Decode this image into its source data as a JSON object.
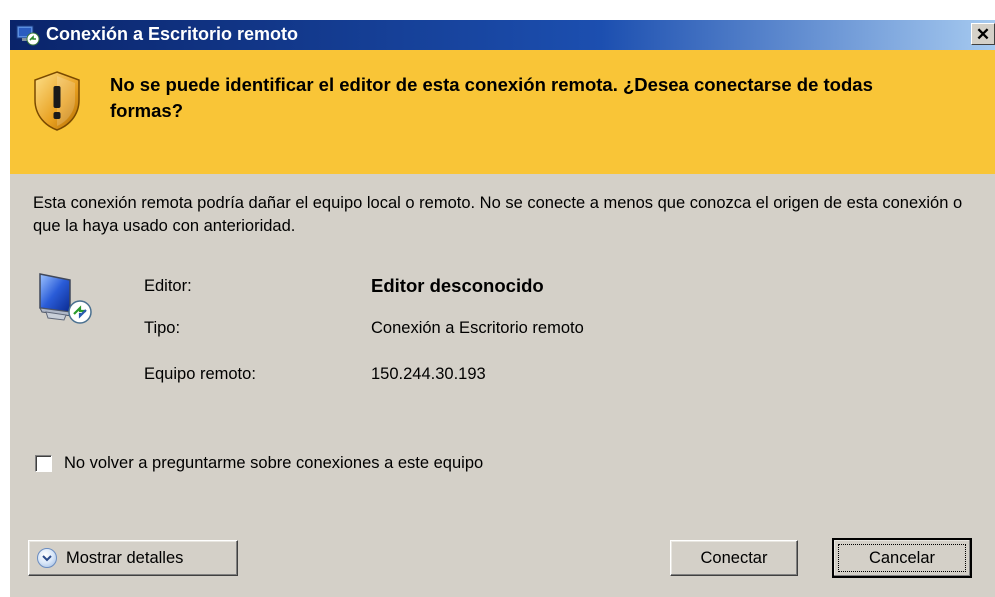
{
  "window": {
    "title": "Conexión a Escritorio remoto",
    "close_label": "✕"
  },
  "warning": {
    "message": "No se puede identificar el editor de esta conexión remota. ¿Desea conectarse de todas formas?",
    "color": "#f9c537"
  },
  "description": "Esta conexión remota podría dañar el equipo local o remoto. No se conecte a menos que conozca el origen de esta conexión o que la haya usado con anterioridad.",
  "info": [
    {
      "label": "Editor:",
      "value": "Editor desconocido"
    },
    {
      "label": "Tipo:",
      "value": "Conexión a Escritorio remoto"
    },
    {
      "label": "Equipo remoto:",
      "value": "150.244.30.193"
    }
  ],
  "checkbox": {
    "label": "No volver a preguntarme sobre conexiones a este equipo",
    "checked": false
  },
  "buttons": {
    "details": "Mostrar detalles",
    "connect": "Conectar",
    "cancel": "Cancelar"
  },
  "icons": {
    "title": "remote-desktop-icon",
    "warning": "shield-warning-icon",
    "computer": "remote-computer-icon",
    "details": "chevron-down-circle-icon"
  }
}
